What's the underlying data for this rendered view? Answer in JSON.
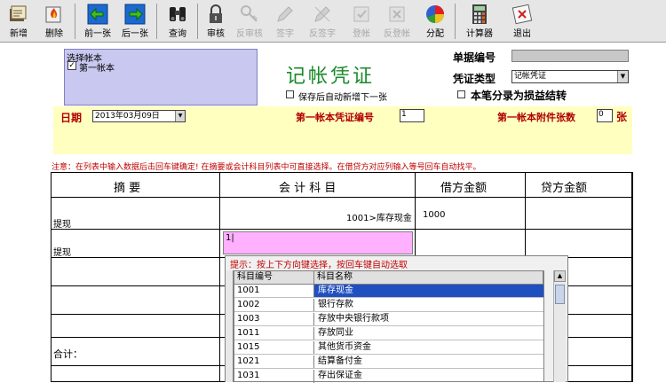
{
  "toolbar": {
    "items": [
      {
        "label": "新增",
        "icon": "new-doc-icon",
        "enabled": true
      },
      {
        "label": "删除",
        "icon": "delete-icon",
        "enabled": true
      },
      {
        "label": "前一张",
        "icon": "arrow-left-icon",
        "enabled": true
      },
      {
        "label": "后一张",
        "icon": "arrow-right-icon",
        "enabled": true
      },
      {
        "label": "查询",
        "icon": "binoculars-icon",
        "enabled": true
      },
      {
        "label": "审核",
        "icon": "lock-icon",
        "enabled": true
      },
      {
        "label": "反审核",
        "icon": "key-icon",
        "enabled": false
      },
      {
        "label": "签字",
        "icon": "pen-icon",
        "enabled": false
      },
      {
        "label": "反签字",
        "icon": "pen-off-icon",
        "enabled": false
      },
      {
        "label": "登帐",
        "icon": "post-icon",
        "enabled": false
      },
      {
        "label": "反登帐",
        "icon": "unpost-icon",
        "enabled": false
      },
      {
        "label": "分配",
        "icon": "pie-chart-icon",
        "enabled": true
      },
      {
        "label": "计算器",
        "icon": "calculator-icon",
        "enabled": true
      },
      {
        "label": "退出",
        "icon": "exit-icon",
        "enabled": true
      }
    ]
  },
  "account_box": {
    "title": "选择帐本",
    "checkbox_mark": "✓",
    "account": "第一帐本"
  },
  "header": {
    "title": "记帐凭证",
    "auto_new_label": "保存后自动新增下一张",
    "doc_no_label": "单据编号",
    "doc_no_value": "",
    "voucher_type_label": "凭证类型",
    "voucher_type_value": "记帐凭证",
    "profit_loss_label": "本笔分录为损益结转"
  },
  "date_row": {
    "date_label": "日期",
    "date_value": "2013年03月09日",
    "voucher_no_label": "第一帐本凭证编号",
    "voucher_no_value": "1",
    "attach_label": "第一帐本附件张数",
    "attach_value": "0",
    "attach_unit": "张"
  },
  "notice": "注意：在列表中输入数据后击回车键确定! 在摘要或会计科目列表中可直接选择。在借贷方对应列输入等号回车自动找平。",
  "grid": {
    "headers": [
      "摘 要",
      "会 计 科 目",
      "借方金额",
      "贷方金额"
    ],
    "rows": [
      {
        "summary": "提现",
        "account": "1001>库存现金",
        "debit": "1000",
        "credit": ""
      },
      {
        "summary": "提现",
        "account": "1|",
        "debit": "",
        "credit": ""
      }
    ],
    "total_label": "合计："
  },
  "popup": {
    "hint": "提示：按上下方向键选择，按回车键自动选取",
    "col_code": "科目编号",
    "col_name": "科目名称",
    "rows": [
      {
        "code": "1001",
        "name": "库存现金",
        "selected": true
      },
      {
        "code": "1002",
        "name": "银行存款",
        "selected": false
      },
      {
        "code": "1003",
        "name": "存放中央银行款项",
        "selected": false
      },
      {
        "code": "1011",
        "name": "存放同业",
        "selected": false
      },
      {
        "code": "1015",
        "name": "其他货币资金",
        "selected": false
      },
      {
        "code": "1021",
        "name": "结算备付金",
        "selected": false
      },
      {
        "code": "1031",
        "name": "存出保证金",
        "selected": false
      }
    ]
  }
}
